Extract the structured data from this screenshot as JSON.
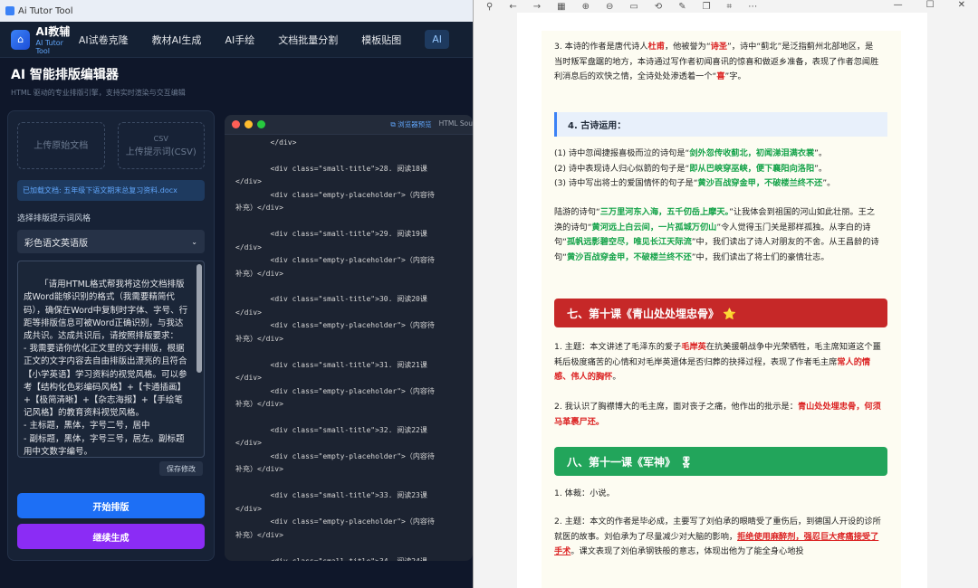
{
  "app": {
    "window_title": "Ai Tutor Tool",
    "brand_name": "AI教辅",
    "brand_sub": "AI Tutor Tool",
    "nav": [
      "AI试卷克隆",
      "教材AI生成",
      "AI手绘",
      "文档批量分割",
      "模板贴图",
      "AI"
    ],
    "page_title": "AI 智能排版编辑器",
    "page_subtitle": "HTML 驱动的专业排版引擎，支持实时渲染与交互编辑",
    "upload_doc": "上传原始文档",
    "upload_csv_top": "CSV",
    "upload_csv": "上传提示词(CSV)",
    "loaded_file": "已加载文档: 五年级下语文期末总复习资料.docx",
    "style_label": "选择排版提示词风格",
    "style_selected": "彩色语文英语版",
    "prompt_text": "「请用HTML格式帮我将这份文档排版成Word能够识别的格式（我需要精简代码），确保在Word中复制时字体、字号、行距等排版信息可被Word正确识别，与我达成共识。达成共识后，请按照排版要求：\n- 我需要请你优化正文里的文字排版，根据正文的文字内容去自由排版出漂亮的且符合【小学英语】学习资料的视觉风格。可以参考【结构化色彩编码风格】+【卡通插画】+【极简清晰】+【杂志海报】+【手绘笔记风格】的教育资料视觉风格。\n- 主标题，黑体，字号二号，居中\n- 副标题，黑体，字号三号，居左。副标题用中文数字编号。",
    "save_label": "保存修改",
    "start_label": "开始排版",
    "continue_label": "继续生成",
    "code_preview_tab": "浏览器预览",
    "code_source_tab": "HTML Sou"
  },
  "code_lines": [
    "        </div>",
    "",
    "        <div class=\"small-title\">28. 阅读18课",
    "</div>",
    "        <div class=\"empty-placeholder\">（内容待",
    "补充）</div>",
    "",
    "        <div class=\"small-title\">29. 阅读19课",
    "</div>",
    "        <div class=\"empty-placeholder\">（内容待",
    "补充）</div>",
    "",
    "        <div class=\"small-title\">30. 阅读20课",
    "</div>",
    "        <div class=\"empty-placeholder\">（内容待",
    "补充）</div>",
    "",
    "        <div class=\"small-title\">31. 阅读21课",
    "</div>",
    "        <div class=\"empty-placeholder\">（内容待",
    "补充）</div>",
    "",
    "        <div class=\"small-title\">32. 阅读22课",
    "</div>",
    "        <div class=\"empty-placeholder\">（内容待",
    "补充）</div>",
    "",
    "        <div class=\"small-title\">33. 阅读23课",
    "</div>",
    "        <div class=\"empty-placeholder\">（内容待",
    "补充）</div>",
    "",
    "        <div class=\"small-title\">34. 阅读24课"
  ],
  "doc": {
    "p1_a": "3. 本诗的作者是唐代诗人",
    "p1_poet": "杜甫",
    "p1_b": "，他被誉为“",
    "p1_title": "诗圣",
    "p1_c": "”，诗中“蓟北”是泛指蓟州北部地区，是当时叛军盘踞的地方，本诗通过写作者初闻喜讯的惊喜和做返乡准备，表现了作者忽闻胜利消息后的欢快之情，全诗处处渗透着一个“",
    "p1_xi": "喜",
    "p1_d": "”字。",
    "sec4": "4. 古诗运用：",
    "l1_a": "(1) 诗中忽闻捷报喜极而泣的诗句是“",
    "l1_b": "剑外忽传收蓟北，初闻涕泪满衣裳",
    "l1_c": "”。",
    "l2_a": "(2) 诗中表现诗人归心似箭的句子是“",
    "l2_b": "即从巴峡穿巫峡，便下襄阳向洛阳",
    "l2_c": "”。",
    "l3_a": "(3) 诗中写出将士的爱国情怀的句子是“",
    "l3_b": "黄沙百战穿金甲，不破楼兰终不还",
    "l3_c": "”。",
    "p2_a": "陆游的诗句“",
    "p2_q1": "三万里河东入海，五千仞岳上摩天。",
    "p2_b": "”让我体会到祖国的河山如此壮丽。王之涣的诗句“",
    "p2_q2": "黄河远上白云间，一片孤城万仞山",
    "p2_c": "”令人觉得玉门关是那样孤独。从李白的诗句“",
    "p2_q3": "孤帆远影碧空尽，唯见长江天际流",
    "p2_d": "”中，我们读出了诗人对朋友的不舍。从王昌龄的诗句“",
    "p2_q4": "黄沙百战穿金甲，不破楼兰终不还",
    "p2_e": "”中，我们读出了将士们的豪情壮志。",
    "banner7": "七、第十课《青山处处埋忠骨》 ⭐",
    "b7p1_a": "1. 主题：本文讲述了毛泽东的爱子",
    "b7p1_name": "毛岸英",
    "b7p1_b": "在抗美援朝战争中光荣牺牲，毛主席知道这个噩耗后极度痛苦的心情和对毛岸英遗体是否归葬的抉择过程，表现了作者毛主席",
    "b7p1_emph": "常人的情感、伟人的胸怀",
    "b7p1_c": "。",
    "b7p2_a": "2. 我认识了胸襟博大的毛主席，面对丧子之痛，他作出的批示是：",
    "b7p2_b": "青山处处埋忠骨，何须马革裹尸还。",
    "banner8": "八、第十一课《军神》 🎖",
    "b8p1": "1. 体裁：小说。",
    "b8p2_a": "2. 主题：本文的作者是毕必成，主要写了刘伯承的眼睛受了重伤后，到德国人开设的诊所就医的故事。刘伯承为了尽量减少对大脑的影响，",
    "b8p2_b": "拒绝使用麻醉剂，强忍巨大疼痛接受了手术",
    "b8p2_c": "。课文表现了刘伯承钢铁般的意志，体现出他为了能全身心地投"
  }
}
